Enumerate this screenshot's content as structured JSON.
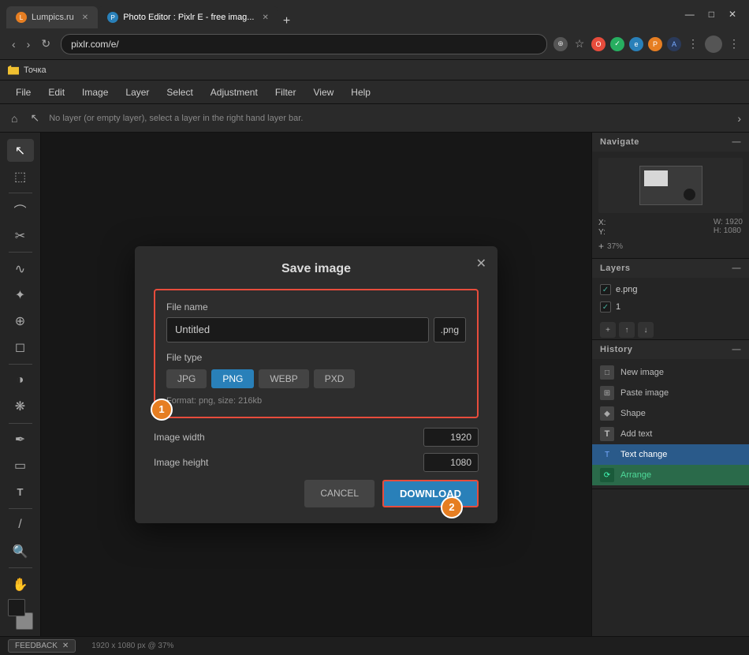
{
  "browser": {
    "tabs": [
      {
        "id": "tab1",
        "favicon_color": "#f0c030",
        "label": "Lumpics.ru",
        "active": false
      },
      {
        "id": "tab2",
        "favicon_color": "#3498db",
        "label": "Photo Editor : Pixlr E - free imag...",
        "active": true
      }
    ],
    "new_tab_label": "+",
    "win_buttons": [
      "—",
      "□",
      "✕"
    ],
    "address": "pixlr.com/e/",
    "bookmark_label": "Точка"
  },
  "app": {
    "menu": [
      "File",
      "Edit",
      "Image",
      "Layer",
      "Select",
      "Adjustment",
      "Filter",
      "View",
      "Help"
    ],
    "toolbar_msg": "No layer (or empty layer), select a layer in the right hand layer bar.",
    "status": "1920 x 1080 px @ 37%"
  },
  "modal": {
    "title": "Save image",
    "file_name_label": "File name",
    "file_name_value": "Untitled",
    "file_ext": ".png",
    "file_type_label": "File type",
    "file_types": [
      "JPG",
      "PNG",
      "WEBP",
      "PXD"
    ],
    "active_type": "PNG",
    "format_info": "Format: png, size: 216kb",
    "image_width_label": "Image width",
    "image_width_value": "1920",
    "image_height_label": "Image height",
    "image_height_value": "1080",
    "cancel_label": "CANCEL",
    "download_label": "DOWNLOAD"
  },
  "panels": {
    "navigate": {
      "title": "Navigate",
      "x_label": "X:",
      "y_label": "Y:",
      "w_label": "W:",
      "w_value": "1920",
      "h_label": "H:",
      "h_value": "1080",
      "zoom": "37%"
    },
    "layers": {
      "title": "Layers",
      "items": [
        {
          "name": "e.png",
          "checked": true
        },
        {
          "name": "1",
          "checked": true
        }
      ]
    },
    "history": {
      "title": "History",
      "items": [
        {
          "name": "New image",
          "active": false
        },
        {
          "name": "Paste image",
          "active": false
        },
        {
          "name": "Shape",
          "active": false
        },
        {
          "name": "Add text",
          "active": false
        },
        {
          "name": "Text change",
          "active": true
        },
        {
          "name": "Arrange",
          "active": false
        }
      ]
    }
  },
  "feedback": {
    "label": "FEEDBACK",
    "close": "✕"
  }
}
